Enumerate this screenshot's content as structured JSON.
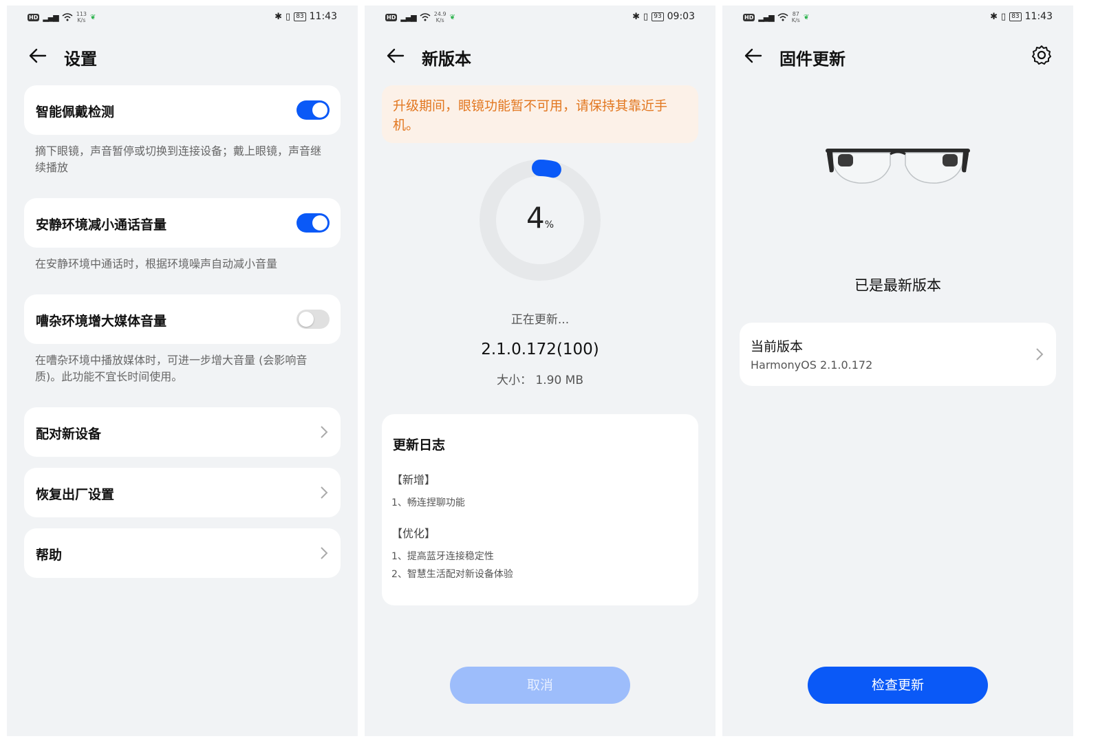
{
  "screen1": {
    "status": {
      "speed_top": "113",
      "speed_unit": "K/s",
      "battery": "83",
      "time": "11:43"
    },
    "title": "设置",
    "settings": [
      {
        "label": "智能佩戴检测",
        "toggle": "on",
        "desc": "摘下眼镜，声音暂停或切换到连接设备；戴上眼镜，声音继续播放"
      },
      {
        "label": "安静环境减小通话音量",
        "toggle": "on",
        "desc": "在安静环境中通话时，根据环境噪声自动减小音量"
      },
      {
        "label": "嘈杂环境增大媒体音量",
        "toggle": "off",
        "desc": "在嘈杂环境中播放媒体时，可进一步增大音量 (会影响音质)。此功能不宜长时间使用。"
      }
    ],
    "links": [
      {
        "label": "配对新设备"
      },
      {
        "label": "恢复出厂设置"
      },
      {
        "label": "帮助"
      }
    ]
  },
  "screen2": {
    "status": {
      "speed_top": "24.9",
      "speed_unit": "K/s",
      "battery": "93",
      "time": "09:03"
    },
    "title": "新版本",
    "warning": "升级期间，眼镜功能暂不可用，请保持其靠近手机。",
    "progress": {
      "value": 4,
      "value_text": "4",
      "unit": "%"
    },
    "status_text": "正在更新...",
    "version": "2.1.0.172(100)",
    "size": "大小：  1.90 MB",
    "changelog": {
      "title": "更新日志",
      "sections": [
        {
          "heading": "【新增】",
          "items": [
            "1、畅连捏聊功能"
          ]
        },
        {
          "heading": "【优化】",
          "items": [
            "1、提高蓝牙连接稳定性",
            "2、智慧生活配对新设备体验"
          ]
        }
      ]
    },
    "cancel_label": "取消"
  },
  "screen3": {
    "status": {
      "speed_top": "87",
      "speed_unit": "K/s",
      "battery": "83",
      "time": "11:43"
    },
    "title": "固件更新",
    "latest_text": "已是最新版本",
    "current_version_label": "当前版本",
    "current_version_value": "HarmonyOS 2.1.0.172",
    "check_label": "检查更新"
  },
  "colors": {
    "accent": "#0a59f7",
    "warning_text": "#e27720",
    "warning_bg": "#fcf1e8",
    "page_bg": "#f1f3f5",
    "disabled_button": "#9dbdfb"
  }
}
